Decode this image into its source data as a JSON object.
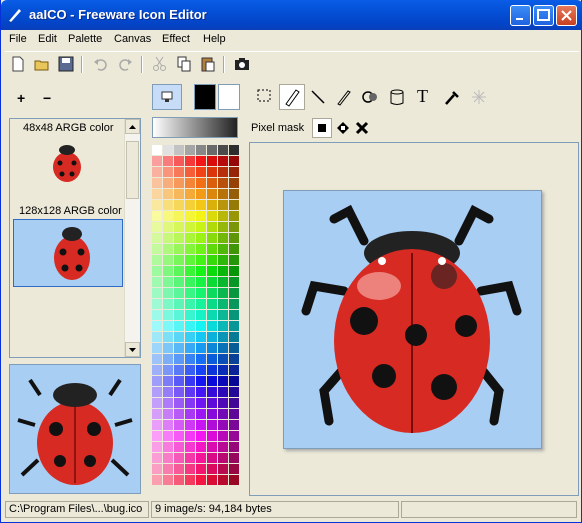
{
  "window": {
    "title": "aaICO - Freeware Icon Editor"
  },
  "menu": [
    "File",
    "Edit",
    "Palette",
    "Canvas",
    "Effect",
    "Help"
  ],
  "toolbar": {
    "icons": [
      "new-icon",
      "open-icon",
      "save-icon",
      "undo-icon",
      "redo-icon",
      "cut-icon",
      "copy-icon",
      "paste-icon",
      "camera-icon"
    ]
  },
  "left": {
    "add_label": "+",
    "remove_label": "−",
    "sizes": [
      {
        "label": "48x48 ARGB color"
      },
      {
        "label": "128x128 ARGB color"
      }
    ]
  },
  "tools": {
    "icons": [
      "select-icon",
      "pencil-icon",
      "line-icon",
      "brush-icon",
      "fill-icon",
      "bucket-icon",
      "text-icon",
      "picker-icon",
      "magic-icon"
    ],
    "text_glyph": "T"
  },
  "pixel_mask": {
    "label": "Pixel mask"
  },
  "colors": {
    "primary": "#000000",
    "secondary": "#ffffff",
    "canvas_bg": "#a9cef4",
    "bug_red": "#d62a22"
  },
  "status": {
    "path": "C:\\Program Files\\...\\bug.ico",
    "info": "9 image/s: 94,184 bytes"
  }
}
